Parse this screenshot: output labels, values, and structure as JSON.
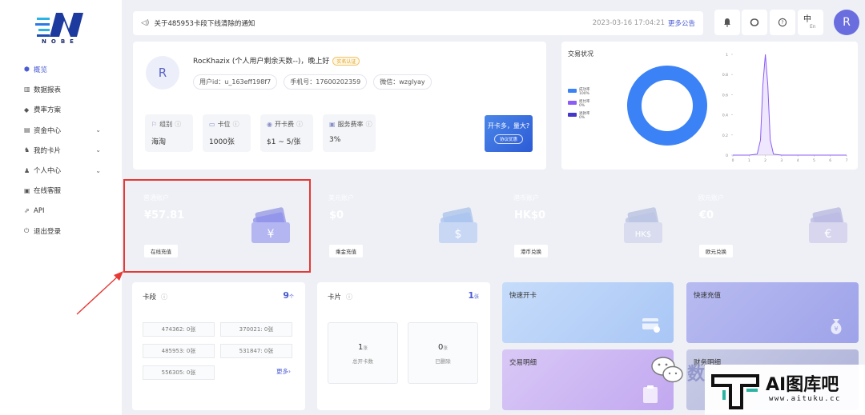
{
  "logo": {
    "word": "NOBE"
  },
  "sidebar": {
    "items": [
      {
        "icon": "dashboard-icon",
        "glyph": "⬢",
        "label": "概览",
        "active": true
      },
      {
        "icon": "chart-icon",
        "glyph": "▥",
        "label": "数据报表"
      },
      {
        "icon": "plan-icon",
        "glyph": "◆",
        "label": "费率方案"
      },
      {
        "icon": "wallet-icon",
        "glyph": "▤",
        "label": "资金中心",
        "expand": true
      },
      {
        "icon": "card-icon",
        "glyph": "♞",
        "label": "我的卡片",
        "expand": true
      },
      {
        "icon": "user-icon",
        "glyph": "♟",
        "label": "个人中心",
        "expand": true
      },
      {
        "icon": "support-icon",
        "glyph": "▣",
        "label": "在线客服"
      },
      {
        "icon": "api-icon",
        "glyph": "⇗",
        "label": "API"
      },
      {
        "icon": "logout-icon",
        "glyph": "⏻",
        "label": "退出登录"
      }
    ]
  },
  "notice": {
    "text": "关于485953卡段下线清除的通知",
    "time": "2023-03-16 17:04:21",
    "more": "更多公告"
  },
  "topbar": {
    "lang_zh": "中",
    "lang_en": "En",
    "avatar": "R"
  },
  "profile": {
    "avatar": "R",
    "name_line": "RocKhazix (个人用户剩余天数--)，晚上好",
    "badge": "实名认证",
    "user_id": "用户id：u_163eff198f7",
    "phone": "手机号：17600202359",
    "wechat": "微信：wzglyay",
    "stats": [
      {
        "label": "组别",
        "value": "海淘"
      },
      {
        "label": "卡位",
        "value": "1000张"
      },
      {
        "label": "开卡费",
        "value": "$1 ~ 5/张"
      },
      {
        "label": "服务费率",
        "value": "3%"
      }
    ],
    "promo_title": "开卡多，量大?",
    "promo_button": "协议优惠"
  },
  "transactions": {
    "title": "交易状况",
    "legend": [
      {
        "name": "成功率",
        "value": "100%",
        "color": "#3b82f6"
      },
      {
        "name": "拒付率",
        "value": "0%",
        "color": "#8b5cf6"
      },
      {
        "name": "退款率",
        "value": "0%",
        "color": "#4338ca"
      }
    ]
  },
  "chart_data": {
    "type": "area",
    "x": [
      0,
      0.5,
      1,
      1.5,
      1.7,
      1.85,
      2,
      2.15,
      2.3,
      2.5,
      3,
      4,
      5,
      6,
      7
    ],
    "y": [
      0,
      0,
      0,
      0.01,
      0.15,
      0.7,
      1,
      0.7,
      0.15,
      0.01,
      0,
      0,
      0,
      0,
      0
    ],
    "xticks": [
      "0",
      "1",
      "2",
      "3",
      "4",
      "5",
      "6",
      "7"
    ],
    "yticks": [
      "0",
      "0.2",
      "0.4",
      "0.6",
      "0.8",
      "1"
    ],
    "xlim": [
      0,
      7
    ],
    "ylim": [
      0,
      1
    ],
    "color": "#8b5cf6",
    "grid": false
  },
  "accounts": [
    {
      "title": "普通账户",
      "value": "¥57.81",
      "button": "在线充值",
      "symbol": "¥",
      "bg": "#3a4368"
    },
    {
      "title": "美元账户",
      "value": "$0",
      "button": "乘金充值",
      "symbol": "$",
      "bg": "#3c4a7f"
    },
    {
      "title": "港币账户",
      "value": "HK$0",
      "button": "港币兑换",
      "symbol": "HK$",
      "bg": "#1f2f6c"
    },
    {
      "title": "欧元账户",
      "value": "€0",
      "button": "欧元兑换",
      "symbol": "€",
      "bg": "#34307e"
    }
  ],
  "segments": {
    "title": "卡段",
    "count": "9",
    "unit": "个",
    "items": [
      "474362: 0张",
      "370021: 0张",
      "485953: 0张",
      "531847: 0张",
      "556305: 0张"
    ],
    "more": "更多"
  },
  "cards": {
    "title": "卡片",
    "count": "1",
    "unit": "张",
    "total_value": "1",
    "total_unit": "张",
    "total_label": "总开卡数",
    "deleted_value": "0",
    "deleted_unit": "张",
    "deleted_label": "已删除"
  },
  "quick": {
    "open_card": "快速开卡",
    "recharge": "快速充值",
    "transactions": "交易明细",
    "finance": "财务明细"
  },
  "watermark": {
    "cn": "AI图库吧",
    "url": "www.aituku.cc",
    "wx": "数"
  }
}
